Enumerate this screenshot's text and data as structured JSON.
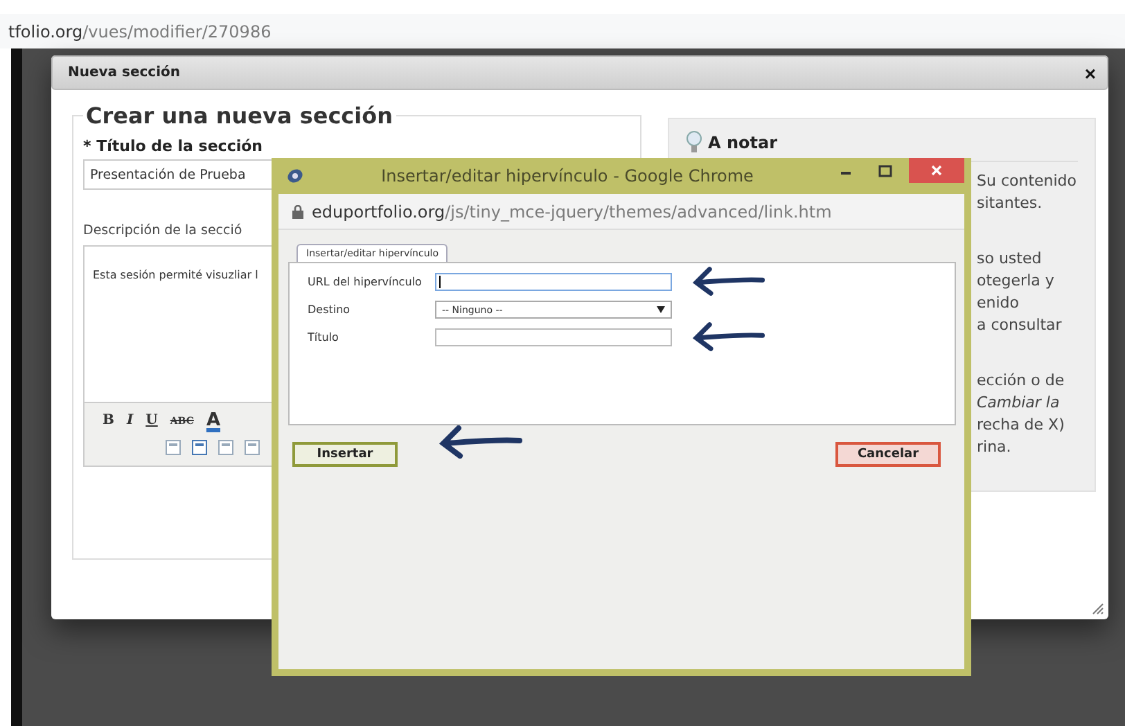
{
  "browser": {
    "url_host": "tfolio.org",
    "url_path": "/vues/modifier/270986"
  },
  "modal": {
    "title": "Nueva sección",
    "close": "×"
  },
  "section_form": {
    "legend": "Crear una nueva sección",
    "title_label": "* Título de la sección",
    "title_value": "Presentación de Prueba",
    "description_label": "Descripción de la secció",
    "description_text": "Esta sesión permité visuzliar l",
    "toolbar": [
      {
        "kind": "bold",
        "label": "B"
      },
      {
        "kind": "italic",
        "label": "I"
      },
      {
        "kind": "underline",
        "label": "U"
      },
      {
        "kind": "strike",
        "label": "ABC"
      },
      {
        "kind": "color",
        "label": "A"
      }
    ]
  },
  "notes": {
    "heading": "A notar",
    "paragraphs": [
      [
        {
          "text": "Su contenido",
          "italic": false
        },
        {
          "text": "sitantes.",
          "italic": false
        }
      ],
      [
        {
          "text": "so usted",
          "italic": false
        },
        {
          "text": "otegerla y",
          "italic": false
        },
        {
          "text": "enido",
          "italic": false
        },
        {
          "text": "a consultar",
          "italic": false
        }
      ],
      [
        {
          "text": "ección o de",
          "italic": false
        },
        {
          "text": "Cambiar la",
          "italic": true
        },
        {
          "text": "recha de X)",
          "italic": false
        },
        {
          "text": "rina.",
          "italic": false
        }
      ]
    ]
  },
  "popup": {
    "title": "Insertar/editar hipervínculo - Google Chrome",
    "url_host": "eduportfolio.org",
    "url_path": "/js/tiny_mce-jquery/themes/advanced/link.htm",
    "tabs": [
      {
        "label": "Insertar/editar hipervínculo",
        "selected": true
      }
    ],
    "fields": [
      {
        "label": "URL del hipervínculo",
        "kind": "text",
        "focused": true,
        "arrow": true
      },
      {
        "label": "Destino",
        "kind": "select",
        "value": "-- Ninguno --",
        "arrow": false
      },
      {
        "label": "Título",
        "kind": "text",
        "focused": false,
        "arrow": true
      }
    ],
    "buttons": [
      {
        "label": "Insertar",
        "kind": "primary",
        "arrow": true
      },
      {
        "label": "Cancelar",
        "kind": "cancel",
        "arrow": false
      }
    ]
  }
}
